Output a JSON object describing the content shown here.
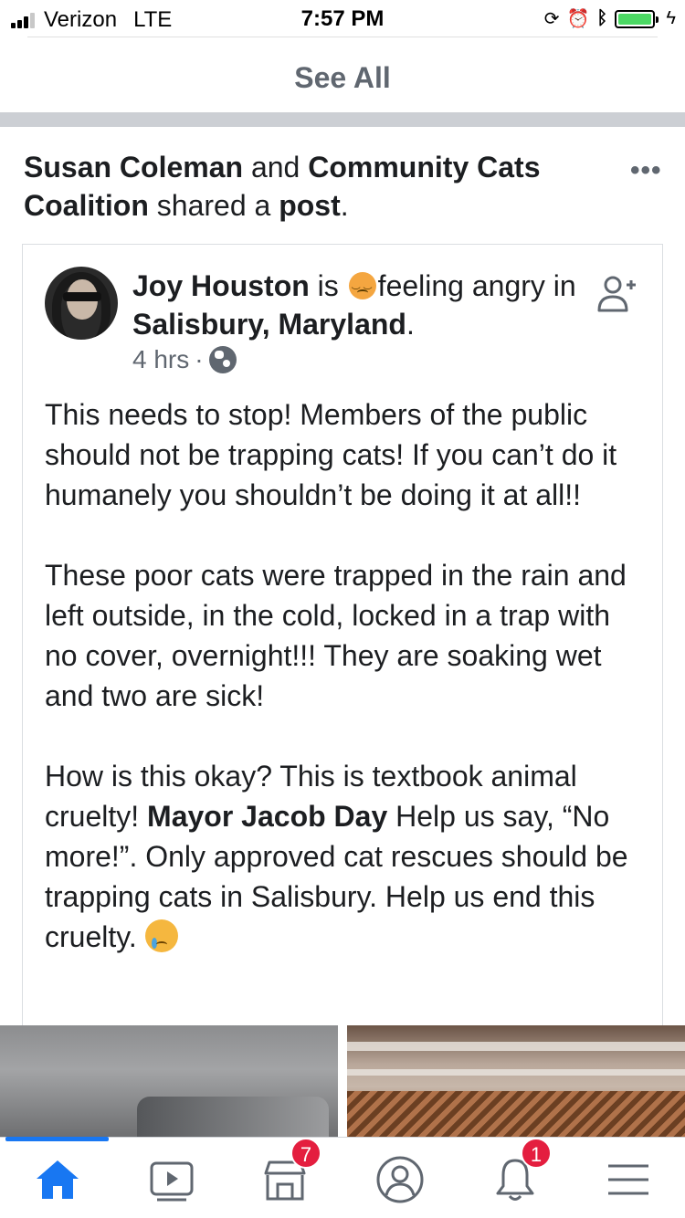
{
  "status_bar": {
    "carrier": "Verizon",
    "network": "LTE",
    "time": "7:57 PM",
    "battery_level": 1.0
  },
  "feed": {
    "see_all": "See All"
  },
  "shared_post": {
    "actor_1": "Susan Coleman",
    "conj": "and",
    "actor_2": "Community Cats Coalition",
    "verb": "shared a",
    "object": "post",
    "period": ".",
    "more_icon": "more-dots-icon"
  },
  "post": {
    "author": "Joy Houston",
    "is_text": "is",
    "feeling_emoji": "angry-face-emoji",
    "feeling_text": "feeling angry",
    "location_prefix": "in",
    "location": "Salisbury, Maryland",
    "location_suffix": ".",
    "time": "4 hrs",
    "separator": "·",
    "privacy_icon": "globe-icon",
    "add_friend_icon": "add-friend-icon",
    "paragraph_1": "This needs to stop! Members of the public should not be trapping cats! If you can’t do it humanely you shouldn’t be doing it at all!!",
    "paragraph_2": "These poor cats were trapped in the rain and left outside, in the cold, locked in a trap with no cover, overnight!!! They are soaking wet and two are sick!",
    "paragraph_3_a": "How is this okay? This is textbook animal cruelty!",
    "paragraph_3_mention": "Mayor Jacob Day",
    "paragraph_3_b": "Help us say, “No more!”. Only approved cat rescues should be trapping cats in Salisbury. Help us end this cruelty.",
    "paragraph_3_emoji": "crying-face-emoji"
  },
  "tab_bar": {
    "items": [
      {
        "icon": "home-icon",
        "active": true
      },
      {
        "icon": "watch-video-icon"
      },
      {
        "icon": "marketplace-icon",
        "badge": "7"
      },
      {
        "icon": "profile-icon"
      },
      {
        "icon": "notifications-bell-icon",
        "badge": "1"
      },
      {
        "icon": "menu-icon"
      }
    ],
    "accent_color": "#1877f2",
    "badge_color": "#e41e3f"
  }
}
